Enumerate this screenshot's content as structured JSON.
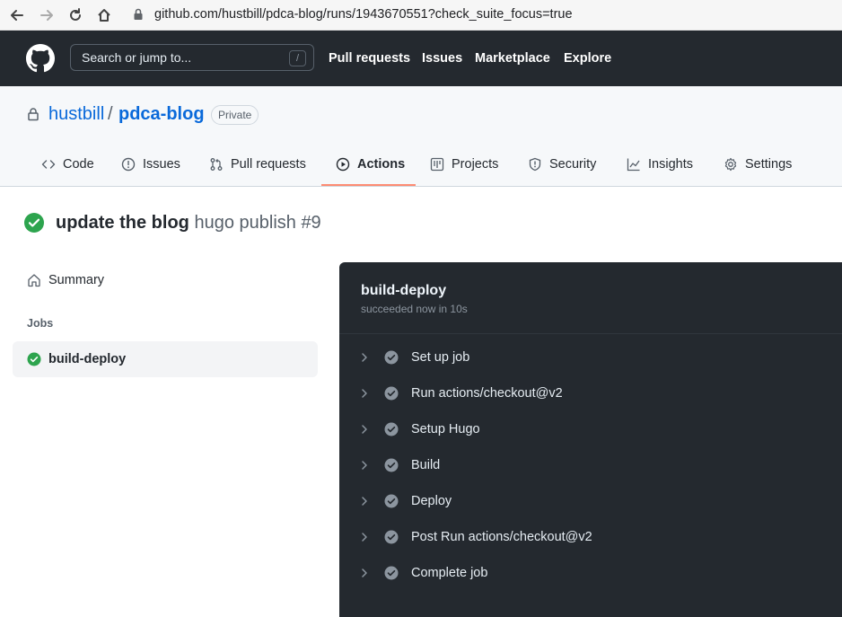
{
  "browser": {
    "url": "github.com/hustbill/pdca-blog/runs/1943670551?check_suite_focus=true"
  },
  "gh_header": {
    "search_placeholder": "Search or jump to...",
    "search_key": "/",
    "nav": [
      "Pull requests",
      "Issues",
      "Marketplace",
      "Explore"
    ]
  },
  "repo": {
    "owner": "hustbill",
    "separator": "/",
    "name": "pdca-blog",
    "visibility": "Private"
  },
  "tabs": [
    {
      "label": "Code",
      "icon": "code-icon"
    },
    {
      "label": "Issues",
      "icon": "issue-icon"
    },
    {
      "label": "Pull requests",
      "icon": "pull-request-icon"
    },
    {
      "label": "Actions",
      "icon": "play-icon",
      "active": true
    },
    {
      "label": "Projects",
      "icon": "project-icon"
    },
    {
      "label": "Security",
      "icon": "shield-icon"
    },
    {
      "label": "Insights",
      "icon": "graph-icon"
    },
    {
      "label": "Settings",
      "icon": "gear-icon"
    }
  ],
  "run": {
    "title": "update the blog",
    "subtitle": "hugo publish #9",
    "status": "success"
  },
  "sidebar": {
    "summary_label": "Summary",
    "jobs_heading": "Jobs",
    "jobs": [
      {
        "label": "build-deploy",
        "status": "success",
        "selected": true
      }
    ]
  },
  "job_log": {
    "title": "build-deploy",
    "subtitle": "succeeded now in 10s",
    "steps": [
      {
        "label": "Set up job"
      },
      {
        "label": "Run actions/checkout@v2"
      },
      {
        "label": "Setup Hugo"
      },
      {
        "label": "Build"
      },
      {
        "label": "Deploy"
      },
      {
        "label": "Post Run actions/checkout@v2"
      },
      {
        "label": "Complete job"
      }
    ]
  },
  "colors": {
    "success": "#2da44e",
    "link": "#0969da",
    "header_bg": "#24292f",
    "active_tab_underline": "#fd8c73"
  }
}
